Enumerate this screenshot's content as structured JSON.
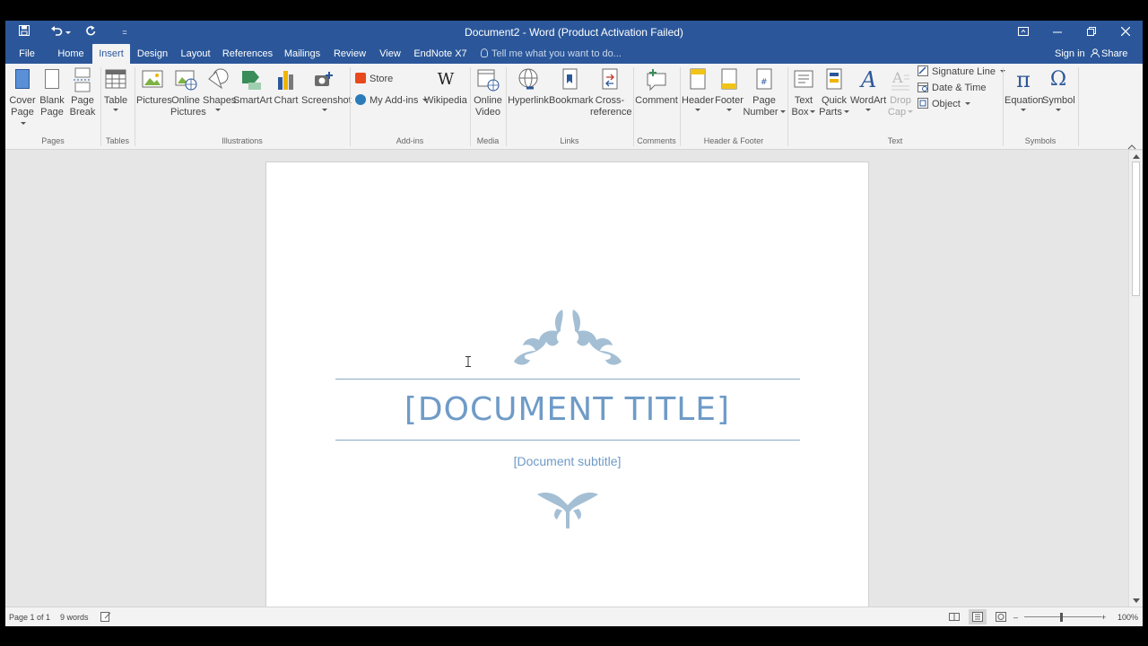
{
  "window": {
    "title": "Document2 - Word (Product Activation Failed)"
  },
  "qat": {
    "save_icon": "save-icon",
    "undo_icon": "undo-icon",
    "redo_icon": "redo-icon",
    "customize_icon": "customize-qat-icon"
  },
  "tabs": [
    {
      "label": "File"
    },
    {
      "label": "Home"
    },
    {
      "label": "Insert"
    },
    {
      "label": "Design"
    },
    {
      "label": "Layout"
    },
    {
      "label": "References"
    },
    {
      "label": "Mailings"
    },
    {
      "label": "Review"
    },
    {
      "label": "View"
    },
    {
      "label": "EndNote X7"
    }
  ],
  "tell_me": {
    "placeholder": "Tell me what you want to do..."
  },
  "account": {
    "sign_in": "Sign in",
    "share": "Share"
  },
  "ribbon": {
    "pages": {
      "label": "Pages",
      "cover_page": [
        "Cover",
        "Page"
      ],
      "blank_page": [
        "Blank",
        "Page"
      ],
      "page_break": [
        "Page",
        "Break"
      ]
    },
    "tables": {
      "label": "Tables",
      "table": "Table"
    },
    "illustrations": {
      "label": "Illustrations",
      "pictures": "Pictures",
      "online_pictures": [
        "Online",
        "Pictures"
      ],
      "shapes": "Shapes",
      "smartart": "SmartArt",
      "chart": "Chart",
      "screenshot": "Screenshot"
    },
    "addins": {
      "label": "Add-ins",
      "store": "Store",
      "my_addins": "My Add-ins",
      "wikipedia": "Wikipedia",
      "wikipedia_glyph": "W"
    },
    "media": {
      "label": "Media",
      "online_video": [
        "Online",
        "Video"
      ]
    },
    "links": {
      "label": "Links",
      "hyperlink": "Hyperlink",
      "bookmark": "Bookmark",
      "cross_reference": [
        "Cross-",
        "reference"
      ]
    },
    "comments": {
      "label": "Comments",
      "comment": "Comment"
    },
    "header_footer": {
      "label": "Header & Footer",
      "header": "Header",
      "footer": "Footer",
      "page_number": [
        "Page",
        "Number"
      ]
    },
    "text": {
      "label": "Text",
      "text_box": [
        "Text",
        "Box"
      ],
      "quick_parts": [
        "Quick",
        "Parts"
      ],
      "wordart": "WordArt",
      "drop_cap": [
        "Drop",
        "Cap"
      ],
      "signature_line": "Signature Line",
      "date_time": "Date & Time",
      "object": "Object"
    },
    "symbols": {
      "label": "Symbols",
      "equation": "Equation",
      "symbol": "Symbol",
      "pi_glyph": "π",
      "omega_glyph": "Ω"
    }
  },
  "document": {
    "title": "[DOCUMENT TITLE]",
    "subtitle": "[Document subtitle]"
  },
  "status": {
    "page": "Page 1 of 1",
    "words": "9 words",
    "zoom": "100%",
    "zoom_level_percent": 100
  },
  "colors": {
    "word_blue": "#2b579a",
    "title_text": "#6f9bc7",
    "ornament": "#a4bfd4"
  }
}
